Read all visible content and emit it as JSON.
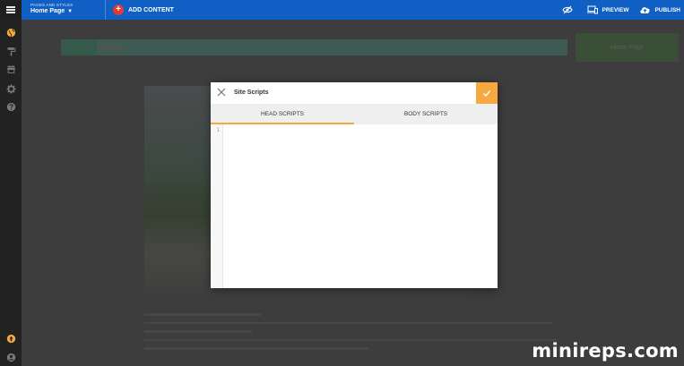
{
  "topbar": {
    "pages_label": "PAGES AND STYLES",
    "current_page": "Home Page",
    "add_content_label": "ADD CONTENT",
    "preview_label": "PREVIEW",
    "publish_label": "PUBLISH"
  },
  "background": {
    "header_title": "ouse",
    "home_button_label": "Home Page"
  },
  "modal": {
    "title": "Site Scripts",
    "tabs": [
      {
        "label": "HEAD SCRIPTS",
        "active": true
      },
      {
        "label": "BODY SCRIPTS",
        "active": false
      }
    ],
    "line_number": "1",
    "accent_color": "#f6a940"
  },
  "watermark": "minireps.com",
  "colors": {
    "topbar": "#0f5fc4",
    "rail": "#222222",
    "add_button": "#e53935",
    "active_rail_icon": "#f6a940"
  }
}
